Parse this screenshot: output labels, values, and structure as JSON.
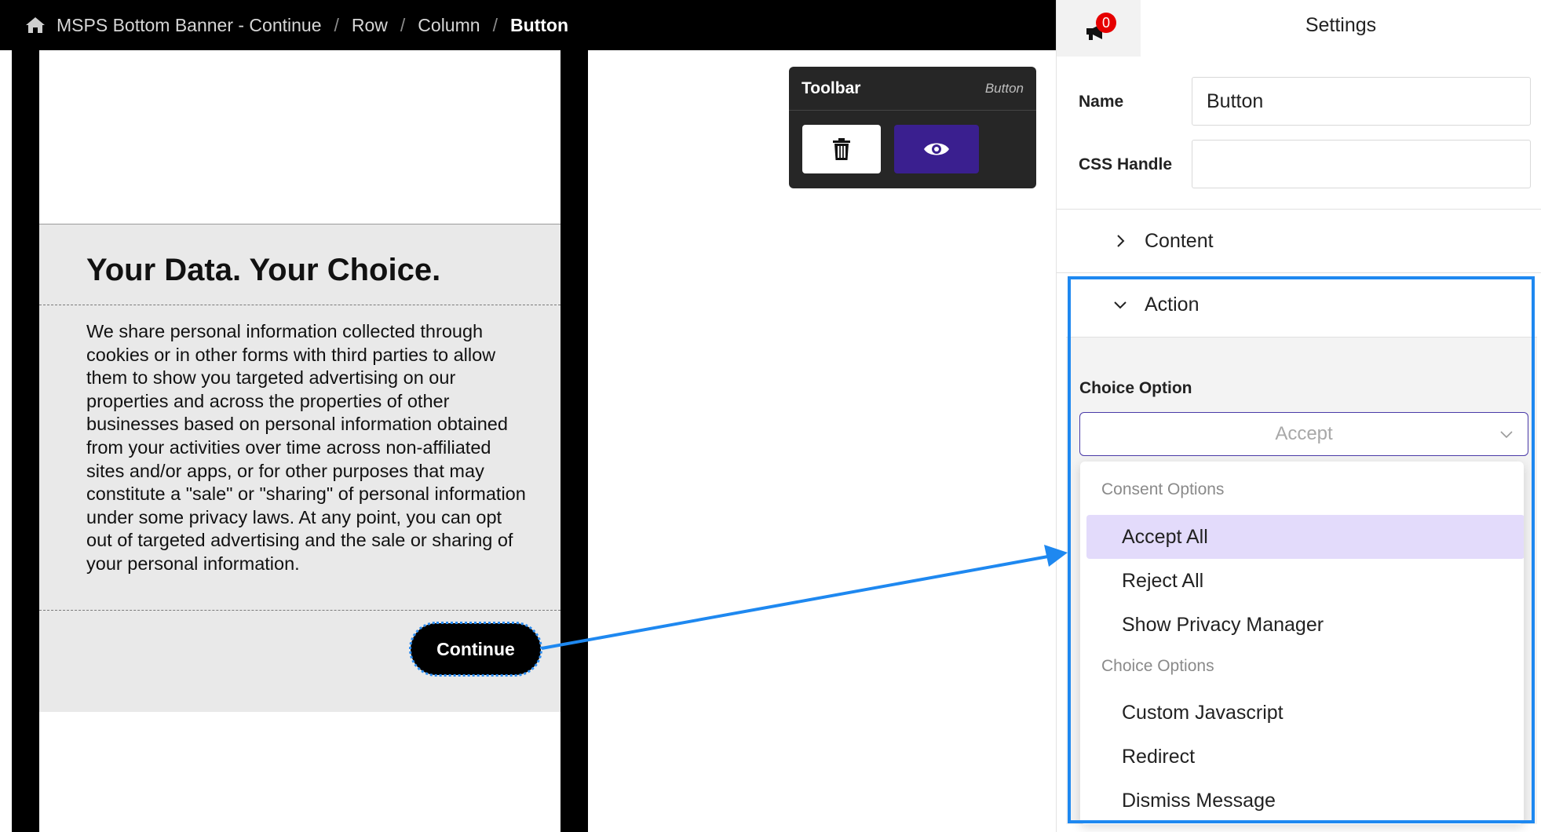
{
  "breadcrumb": {
    "items": [
      "MSPS Bottom Banner - Continue",
      "Row",
      "Column",
      "Button"
    ],
    "separator": "/"
  },
  "banner": {
    "title": "Your Data. Your Choice.",
    "body": "We share personal information collected through cookies or in other forms with third parties to allow them to show you targeted advertising on our properties and across the properties of other businesses based on personal information obtained from your activities over time across non-affiliated sites and/or apps, or for other purposes that may constitute a \"sale\" or \"sharing\" of personal information under some privacy laws. At any point, you can opt out of targeted advertising and the sale or sharing of your personal information.",
    "button_label": "Continue"
  },
  "toolbar": {
    "title": "Toolbar",
    "subtitle": "Button",
    "delete_icon": "trash-icon",
    "preview_icon": "eye-icon"
  },
  "settings": {
    "badge_count": "0",
    "title": "Settings",
    "name_label": "Name",
    "name_value": "Button",
    "css_label": "CSS Handle",
    "css_value": "",
    "content_label": "Content",
    "action_label": "Action",
    "choice_label": "Choice Option",
    "choice_value": "Accept",
    "dropdown": {
      "group1": "Consent Options",
      "items1": [
        "Accept All",
        "Reject All",
        "Show Privacy Manager"
      ],
      "group2": "Choice Options",
      "items2": [
        "Custom Javascript",
        "Redirect",
        "Dismiss Message"
      ],
      "selected": "Accept All"
    }
  },
  "colors": {
    "accent_purple": "#3a1f8f",
    "highlight_blue": "#1e88f0",
    "selected_bg": "#e3dbfb",
    "badge_red": "#e60000"
  }
}
